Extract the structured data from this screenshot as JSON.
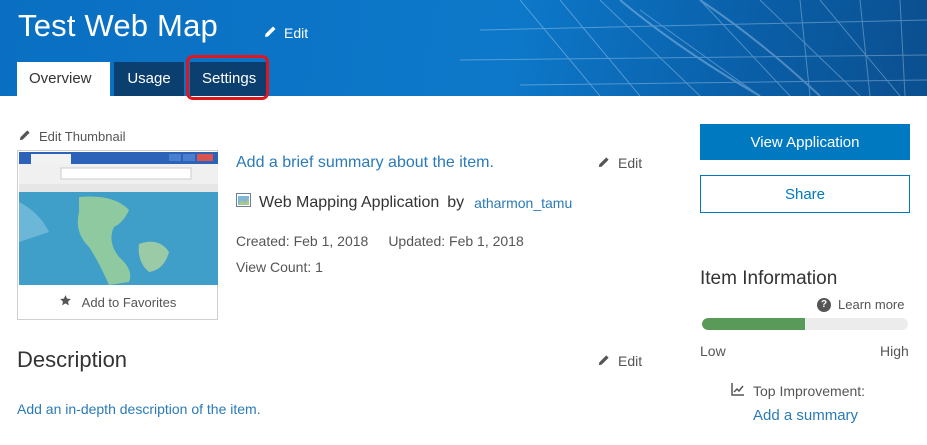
{
  "header": {
    "title": "Test Web Map",
    "edit_label": "Edit",
    "tabs": [
      {
        "label": "Overview",
        "active": true
      },
      {
        "label": "Usage",
        "active": false
      },
      {
        "label": "Settings",
        "active": false
      }
    ]
  },
  "thumbnail": {
    "edit_label": "Edit Thumbnail",
    "favorites_label": "Add to Favorites"
  },
  "details": {
    "summary_placeholder": "Add a brief summary about the item.",
    "summary_edit_label": "Edit",
    "type": "Web Mapping Application",
    "by_label": "by",
    "owner": "atharmon_tamu",
    "created": "Created: Feb 1, 2018",
    "updated": "Updated: Feb 1, 2018",
    "view_count": "View Count: 1"
  },
  "description": {
    "heading": "Description",
    "edit_label": "Edit",
    "placeholder": "Add an in-depth description of the item."
  },
  "actions": {
    "view_application": "View Application",
    "share": "Share"
  },
  "item_information": {
    "heading": "Item Information",
    "learn_more": "Learn more",
    "score_fraction": 0.5,
    "low_label": "Low",
    "high_label": "High",
    "top_improvement_label": "Top Improvement:",
    "top_improvement_link": "Add a summary"
  },
  "colors": {
    "header_blue": "#0b74c4",
    "tab_dark": "#0b3f70",
    "accent": "#0079c1",
    "link": "#2a7ab8",
    "score_green": "#5a9a59",
    "highlight_red": "#e0161c"
  },
  "icons": [
    "pencil-icon",
    "star-icon",
    "question-icon",
    "web-app-icon",
    "chart-improve-icon"
  ]
}
